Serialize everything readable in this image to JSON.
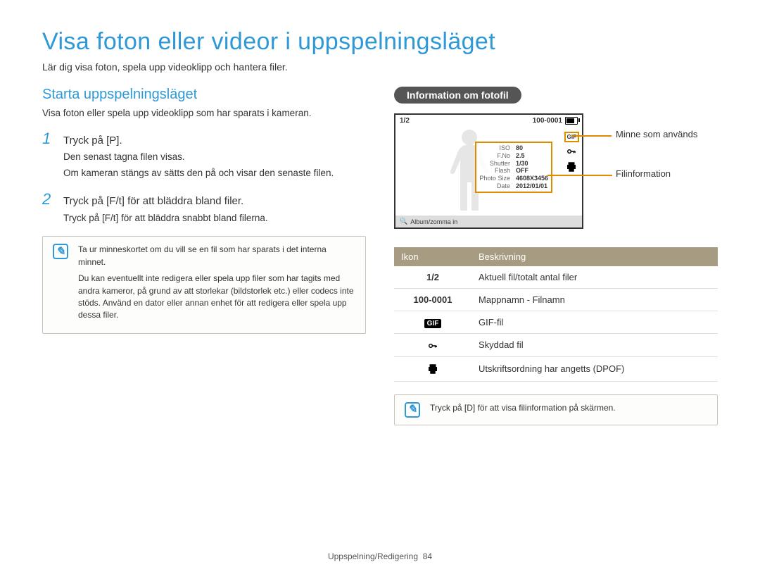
{
  "page": {
    "title": "Visa foton eller videor i uppspelningsläget",
    "subtitle": "Lär dig visa foton, spela upp videoklipp och hantera filer."
  },
  "left": {
    "section_title": "Starta uppspelningsläget",
    "section_text": "Visa foton eller spela upp videoklipp som har sparats i kameran.",
    "step1_num": "1",
    "step1_text": "Tryck på [P].",
    "step1_sub1": "Den senast tagna filen visas.",
    "step1_sub2": "Om kameran stängs av sätts den på och visar den senaste filen.",
    "step2_num": "2",
    "step2_text": "Tryck på [F/t] för att bläddra bland filer.",
    "step2_sub1": "Tryck på [F/t] för att bläddra snabbt bland filerna.",
    "note1_p1": "Ta ur minneskortet om du vill se en fil som har sparats i det interna minnet.",
    "note1_p2": "Du kan eventuellt inte redigera eller spela upp filer som har tagits med andra kameror, på grund av att storlekar (bildstorlek etc.) eller codecs inte stöds. Använd en dator eller annan enhet för att redigera eller spela upp dessa filer."
  },
  "right": {
    "pill": "Information om fotofil",
    "callout_memory": "Minne som används",
    "callout_file": "Filinformation",
    "screen": {
      "counter": "1/2",
      "filename": "100-0001",
      "info_rows": [
        {
          "label": "ISO",
          "value": "80"
        },
        {
          "label": "F.No",
          "value": "2.5"
        },
        {
          "label": "Shutter",
          "value": "1/30"
        },
        {
          "label": "Flash",
          "value": "OFF"
        },
        {
          "label": "Photo Size",
          "value": "4608X3456"
        },
        {
          "label": "Date",
          "value": "2012/01/01"
        }
      ],
      "bottom_label": "Album/zomma in",
      "gif_label": "GIF",
      "side_key": "⚿"
    },
    "table": {
      "col1": "Ikon",
      "col2": "Beskrivning",
      "rows": [
        {
          "icon": "1/2",
          "text": "Aktuell fil/totalt antal filer"
        },
        {
          "icon": "100-0001",
          "text": "Mappnamn - Filnamn"
        },
        {
          "icon": "GIF",
          "text": "GIF-fil"
        },
        {
          "icon": "key",
          "text": "Skyddad fil"
        },
        {
          "icon": "printer",
          "text": "Utskriftsordning har angetts (DPOF)"
        }
      ]
    },
    "note2": "Tryck på [D] för att visa filinformation på skärmen."
  },
  "footer": {
    "section": "Uppspelning/Redigering",
    "page": "84"
  }
}
